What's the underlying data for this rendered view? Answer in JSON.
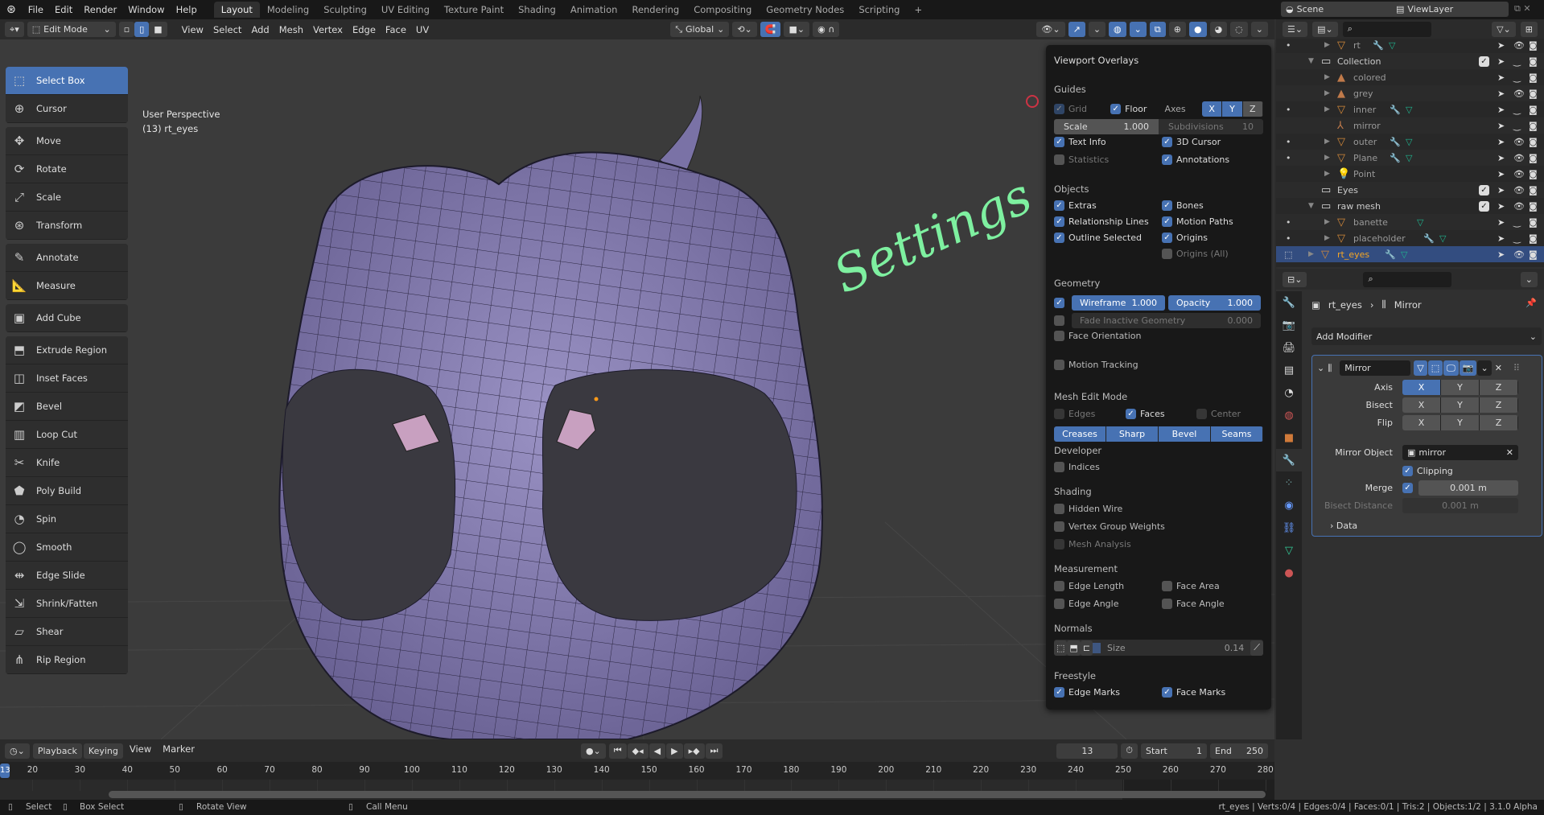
{
  "topbar": {
    "menus": [
      "File",
      "Edit",
      "Render",
      "Window",
      "Help"
    ],
    "workspaces": [
      "Layout",
      "Modeling",
      "Sculpting",
      "UV Editing",
      "Texture Paint",
      "Shading",
      "Animation",
      "Rendering",
      "Compositing",
      "Geometry Nodes",
      "Scripting"
    ],
    "active_workspace": "Layout",
    "add": "+",
    "scene": "Scene",
    "view_layer": "ViewLayer"
  },
  "header": {
    "mode": "Edit Mode",
    "menus": [
      "View",
      "Select",
      "Add",
      "Mesh",
      "Vertex",
      "Edge",
      "Face",
      "UV"
    ],
    "orientation": "Global"
  },
  "viewport": {
    "perspective": "User Perspective",
    "object_info": "(13) rt_eyes",
    "annotation": "Settings",
    "annotation_color": "#7ef0a0"
  },
  "toolbar": {
    "groups": [
      [
        "Select Box",
        "Cursor"
      ],
      [
        "Move",
        "Rotate",
        "Scale",
        "Transform"
      ],
      [
        "Annotate",
        "Measure"
      ],
      [
        "Add Cube"
      ],
      [
        "Extrude Region",
        "Inset Faces",
        "Bevel",
        "Loop Cut",
        "Knife",
        "Poly Build",
        "Spin",
        "Smooth",
        "Edge Slide",
        "Shrink/Fatten",
        "Shear",
        "Rip Region"
      ]
    ],
    "active": "Select Box"
  },
  "overlays": {
    "title": "Viewport Overlays",
    "guides": {
      "label": "Guides",
      "grid": "Grid",
      "floor": "Floor",
      "axes": "Axes",
      "axes_opts": [
        "X",
        "Y",
        "Z"
      ],
      "scale_label": "Scale",
      "scale": "1.000",
      "subdiv_label": "Subdivisions",
      "subdiv": "10",
      "text_info": "Text Info",
      "cursor3d": "3D Cursor",
      "statistics": "Statistics",
      "annotations": "Annotations"
    },
    "objects": {
      "label": "Objects",
      "extras": "Extras",
      "bones": "Bones",
      "rel_lines": "Relationship Lines",
      "motion_paths": "Motion Paths",
      "outline": "Outline Selected",
      "origins": "Origins",
      "origins_all": "Origins (All)"
    },
    "geometry": {
      "label": "Geometry",
      "wireframe_label": "Wireframe",
      "wireframe": "1.000",
      "opacity_label": "Opacity",
      "opacity": "1.000",
      "fade_label": "Fade Inactive Geometry",
      "fade": "0.000",
      "face_orientation": "Face Orientation",
      "motion_tracking": "Motion Tracking"
    },
    "mesh_edit": {
      "label": "Mesh Edit Mode",
      "edges": "Edges",
      "faces": "Faces",
      "center": "Center",
      "buttons": [
        "Creases",
        "Sharp",
        "Bevel",
        "Seams"
      ]
    },
    "developer": {
      "label": "Developer",
      "indices": "Indices"
    },
    "shading": {
      "label": "Shading",
      "hidden_wire": "Hidden Wire",
      "vgw": "Vertex Group Weights",
      "mesh_analysis": "Mesh Analysis"
    },
    "measurement": {
      "label": "Measurement",
      "edge_length": "Edge Length",
      "face_area": "Face Area",
      "edge_angle": "Edge Angle",
      "face_angle": "Face Angle"
    },
    "normals": {
      "label": "Normals",
      "size_label": "Size",
      "size": "0.14"
    },
    "freestyle": {
      "label": "Freestyle",
      "edge_marks": "Edge Marks",
      "face_marks": "Face Marks"
    }
  },
  "outliner": {
    "rows": [
      {
        "name": "rt",
        "icon": "mesh",
        "indent": 2,
        "mod": true,
        "vis": true,
        "dot": true
      },
      {
        "name": "Collection",
        "icon": "collection",
        "indent": 1,
        "check": true,
        "vis": false
      },
      {
        "name": "colored",
        "icon": "image",
        "indent": 2,
        "vis": false
      },
      {
        "name": "grey",
        "icon": "image",
        "indent": 2,
        "vis": true
      },
      {
        "name": "inner",
        "icon": "mesh",
        "indent": 2,
        "mod": true,
        "vis": false,
        "dot": true
      },
      {
        "name": "mirror",
        "icon": "empty",
        "indent": 2,
        "vis": false
      },
      {
        "name": "outer",
        "icon": "mesh",
        "indent": 2,
        "mod": true,
        "vis": true,
        "dot": true
      },
      {
        "name": "Plane",
        "icon": "mesh",
        "indent": 2,
        "mod": true,
        "vis": true,
        "dot": true
      },
      {
        "name": "Point",
        "icon": "light",
        "indent": 2,
        "vis": true
      },
      {
        "name": "Eyes",
        "icon": "collection",
        "indent": 1,
        "check": true,
        "vis": true
      },
      {
        "name": "raw mesh",
        "icon": "collection",
        "indent": 1,
        "check": true,
        "vis": true
      },
      {
        "name": "banette",
        "icon": "mesh",
        "indent": 2,
        "vis": false,
        "dot": true
      },
      {
        "name": "placeholder",
        "icon": "mesh",
        "indent": 2,
        "mod": true,
        "vis": false,
        "dot": true
      },
      {
        "name": "rt_eyes",
        "icon": "mesh",
        "indent": 1,
        "mod": true,
        "vis": true,
        "selected": true
      }
    ]
  },
  "properties": {
    "object": "rt_eyes",
    "modifier_crumb": "Mirror",
    "add_modifier": "Add Modifier",
    "modifier_name": "Mirror",
    "axis_label": "Axis",
    "bisect_label": "Bisect",
    "flip_label": "Flip",
    "xyz": [
      "X",
      "Y",
      "Z"
    ],
    "mirror_object_label": "Mirror Object",
    "mirror_object": "mirror",
    "clipping": "Clipping",
    "merge_label": "Merge",
    "merge": "0.001 m",
    "bisect_distance_label": "Bisect Distance",
    "bisect_distance": "0.001 m",
    "data": "Data"
  },
  "timeline": {
    "menus": [
      "Playback",
      "Keying",
      "View",
      "Marker"
    ],
    "current_frame": "13",
    "start_label": "Start",
    "start": "1",
    "end_label": "End",
    "end": "250",
    "ticks": [
      20,
      30,
      40,
      50,
      60,
      70,
      80,
      90,
      100,
      110,
      120,
      130,
      140,
      150,
      160,
      170,
      180,
      190,
      200,
      210,
      220,
      230,
      240,
      250,
      260,
      270,
      280
    ]
  },
  "status": {
    "select": "Select",
    "box_select": "Box Select",
    "rotate_view": "Rotate View",
    "call_menu": "Call Menu",
    "stats": "rt_eyes | Verts:0/4 | Edges:0/4 | Faces:0/1 | Tris:2 | Objects:1/2 | 3.1.0 Alpha"
  },
  "colors": {
    "accent": "#4772b3",
    "selected_text": "#f5a623"
  }
}
